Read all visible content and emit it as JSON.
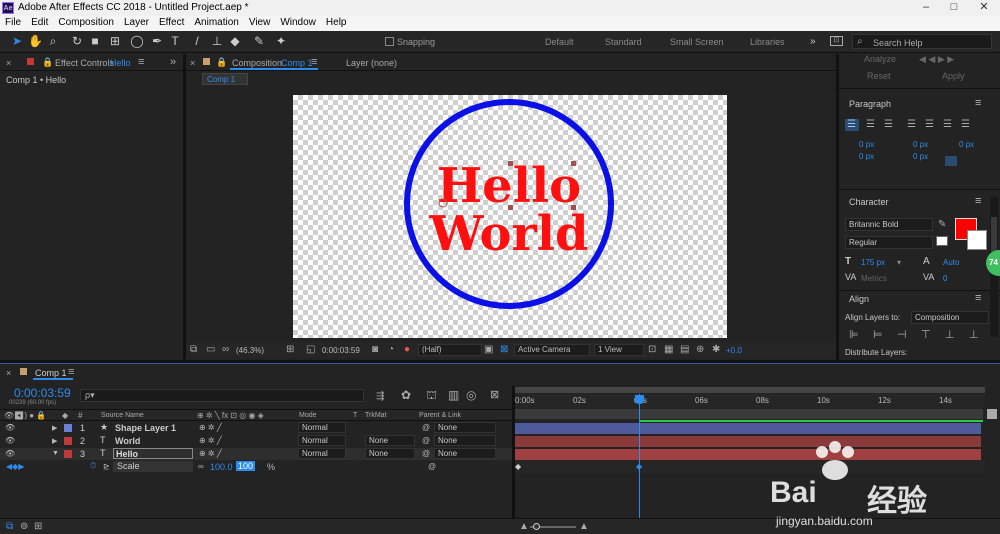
{
  "titlebar": {
    "app_icon": "Ae",
    "title": "Adobe After Effects CC 2018 - Untitled Project.aep *"
  },
  "menu": [
    "File",
    "Edit",
    "Composition",
    "Layer",
    "Effect",
    "Animation",
    "View",
    "Window",
    "Help"
  ],
  "toolbar": {
    "snapping": "Snapping",
    "workspaces": [
      "Default",
      "Standard",
      "Small Screen",
      "Libraries"
    ],
    "search_placeholder": "Search Help"
  },
  "effect_controls": {
    "tab_label": "Effect Controls",
    "tab_target": "Hello",
    "breadcrumb": "Comp 1 • Hello"
  },
  "composition": {
    "tab_label": "Composition",
    "tab_target": "Comp 1",
    "layer_tab": "Layer  (none)",
    "sub_tab": "Comp 1",
    "text_line1": "Hello",
    "text_line2": "World",
    "circle_color": "#0a10e6",
    "text_color": "#ff1010"
  },
  "viewer_bar": {
    "zoom": "(46.3%)",
    "timecode": "0:00:03:59",
    "resolution": "(Half)",
    "camera": "Active Camera",
    "views": "1 View",
    "exposure": "+0.0"
  },
  "right_panel": {
    "top_buttons": {
      "analyze": "Analyze",
      "reset": "Reset",
      "apply": "Apply"
    },
    "paragraph": {
      "title": "Paragraph",
      "indents": [
        "0 px",
        "0 px",
        "0 px",
        "0 px",
        "0 px",
        "0 px"
      ]
    },
    "character": {
      "title": "Character",
      "font": "Britannic Bold",
      "style": "Regular",
      "size": "175 px",
      "leading": "Auto",
      "kerning": "Metrics",
      "tracking": "0",
      "fill_color": "#ff0000"
    },
    "align": {
      "title": "Align",
      "align_to_label": "Align Layers to:",
      "align_to_value": "Composition",
      "distribute_label": "Distribute Layers:"
    },
    "badge": "74"
  },
  "timeline": {
    "tab": "Comp 1",
    "timecode": "0:00:03:59",
    "frame_info": "00239 (60.00 fps)",
    "search_placeholder": "ρ▾",
    "headers": {
      "source": "Source Name",
      "mode": "Mode",
      "t": "T",
      "trkmat": "TrkMat",
      "parent": "Parent & Link"
    },
    "ruler": [
      "0:00s",
      "02s",
      "04s",
      "06s",
      "08s",
      "10s",
      "12s",
      "14s"
    ],
    "layers": [
      {
        "num": "1",
        "type": "★",
        "name": "Shape Layer 1",
        "mode": "Normal",
        "trkmat": "",
        "parent": "None",
        "color": "#6a7fd6",
        "bar_color": "#4e5a99"
      },
      {
        "num": "2",
        "type": "T",
        "name": "World",
        "mode": "Normal",
        "trkmat": "None",
        "parent": "None",
        "color": "#c03a3a",
        "bar_color": "#8a3a3a"
      },
      {
        "num": "3",
        "type": "T",
        "name": "Hello",
        "mode": "Normal",
        "trkmat": "None",
        "parent": "None",
        "color": "#c03a3a",
        "bar_color": "#a04040"
      }
    ],
    "scale": {
      "label": "Scale",
      "v1": "100.0",
      "v2": "100",
      "unit": "%"
    }
  },
  "watermark": {
    "brand": "Bai",
    "brand2": "经验",
    "url": "jingyan.baidu.com"
  }
}
